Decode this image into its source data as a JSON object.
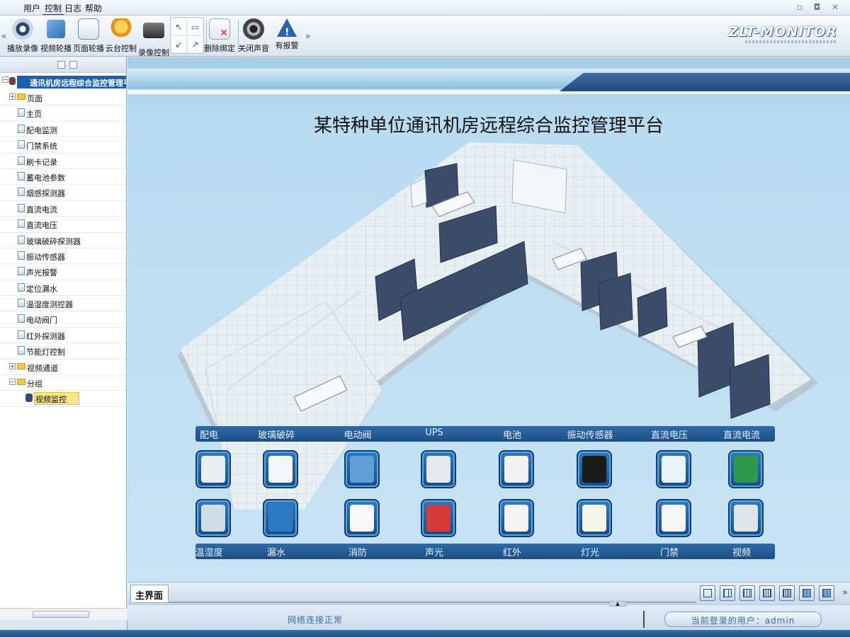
{
  "menu": {
    "user": "用户",
    "control": "控制",
    "log": "日志",
    "help": "帮助"
  },
  "window_buttons": "▫ ◘ ✕",
  "toolbar": {
    "collapse_left": "«",
    "expand_right": "»",
    "buttons": [
      {
        "label": "播放录像",
        "icon": "film-reel-icon"
      },
      {
        "label": "视频轮播",
        "icon": "video-carousel-icon"
      },
      {
        "label": "页面轮播",
        "icon": "page-carousel-icon"
      },
      {
        "label": "云台控制",
        "icon": "ptz-control-icon"
      },
      {
        "label": "录像控制",
        "icon": "recorder-icon"
      },
      {
        "label": "删除绑定",
        "icon": "delete-binding-icon"
      },
      {
        "label": "关闭声音",
        "icon": "speaker-icon"
      },
      {
        "label": "有报警",
        "icon": "alarm-icon"
      }
    ],
    "logo": "ZLT-MONITOR"
  },
  "tree": {
    "root": "通讯机房远程综合监控管理平台",
    "pages_folder": "页面",
    "pages": [
      "主页",
      "配电监测",
      "门禁系统",
      "刷卡记录",
      "蓄电池参数",
      "烟感探测器",
      "直流电流",
      "直流电压",
      "玻璃破碎探测器",
      "振动传感器",
      "声光报警",
      "定位漏水",
      "温湿度测控器",
      "电动阀门",
      "红外探测器",
      "节能灯控制"
    ],
    "video_folder": "视频通道",
    "group_folder": "分组",
    "group_item": "视频监控",
    "expand_plus": "+",
    "expand_minus": "−"
  },
  "main": {
    "title": "某特种单位通讯机房远程综合监控管理平台",
    "top_categories": [
      "配电",
      "玻璃破碎",
      "电动阀",
      "UPS",
      "电池",
      "振动传感器",
      "直流电压",
      "直流电流"
    ],
    "bottom_categories": [
      "温湿度",
      "漏水",
      "消防",
      "声光",
      "红外",
      "灯光",
      "门禁",
      "视频"
    ]
  },
  "tabs": {
    "main_tab": "主界面",
    "more": "»"
  },
  "status": {
    "network": "网络连接正常",
    "user_label": "当前登录的用户：admin"
  },
  "colors": {
    "accent": "#1b5fb0",
    "panel_blue": "#2f6aa6",
    "floor": "#e7eff4"
  }
}
